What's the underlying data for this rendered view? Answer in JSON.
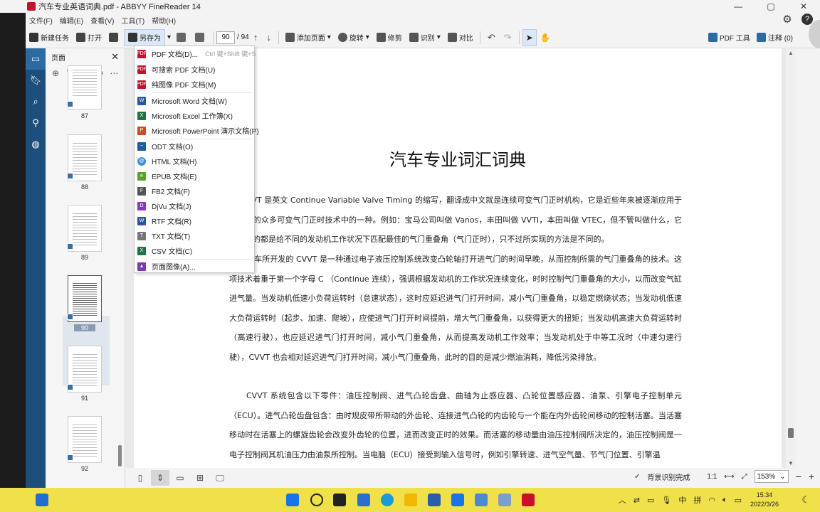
{
  "window": {
    "title": "汽车专业英语词典.pdf - ABBYY FineReader 14",
    "controls": [
      "—",
      "▢",
      "✕"
    ]
  },
  "menu": {
    "items": [
      "文件(F)",
      "编辑(E)",
      "查看(V)",
      "工具(T)",
      "帮助(H)"
    ]
  },
  "toolbar": {
    "new_task": "新建任务",
    "open": "打开",
    "save_as": "另存为",
    "page_current": "90",
    "page_total": "/ 94",
    "add_page": "添加页面",
    "rotate": "旋转",
    "edit": "修剪",
    "recognize": "识别",
    "compare": "对比",
    "pdf_tools": "PDF 工具",
    "comments": "注释 (0)"
  },
  "pages_panel": {
    "title": "页面",
    "thumbnails": [
      "87",
      "88",
      "89",
      "90",
      "91",
      "92"
    ],
    "selected": "90"
  },
  "save_as_menu": [
    {
      "label": "PDF 文档(D)...",
      "shortcut": "Ctrl 键+Shift 键+S",
      "icon": "pdf-icon",
      "color": "#c8102e"
    },
    {
      "label": "可搜索 PDF 文档(U)",
      "shortcut": "",
      "icon": "pdf-icon",
      "color": "#c8102e"
    },
    {
      "label": "纯图像 PDF 文档(M)",
      "shortcut": "",
      "icon": "pdf-icon",
      "color": "#c8102e"
    },
    {
      "label": "Microsoft Word 文档(W)",
      "shortcut": "",
      "icon": "word-icon",
      "color": "#2b579a"
    },
    {
      "label": "Microsoft Excel 工作簿(X)",
      "shortcut": "",
      "icon": "excel-icon",
      "color": "#217346"
    },
    {
      "label": "Microsoft PowerPoint 演示文稿(P)",
      "shortcut": "",
      "icon": "powerpoint-icon",
      "color": "#d24726"
    },
    {
      "label": "ODT 文档(O)",
      "shortcut": "",
      "icon": "odt-icon",
      "color": "#1e5aa0"
    },
    {
      "label": "HTML 文档(H)",
      "shortcut": "",
      "icon": "html-icon",
      "color": "#3c8ed6"
    },
    {
      "label": "EPUB 文档(E)",
      "shortcut": "",
      "icon": "epub-icon",
      "color": "#5aa02c"
    },
    {
      "label": "FB2 文档(F)",
      "shortcut": "",
      "icon": "fb2-icon",
      "color": "#555555"
    },
    {
      "label": "DjVu 文档(J)",
      "shortcut": "",
      "icon": "djvu-icon",
      "color": "#8a3ab9"
    },
    {
      "label": "RTF 文档(R)",
      "shortcut": "",
      "icon": "rtf-icon",
      "color": "#2b579a"
    },
    {
      "label": "TXT 文档(T)",
      "shortcut": "",
      "icon": "txt-icon",
      "color": "#777777"
    },
    {
      "label": "CSV 文档(C)",
      "shortcut": "",
      "icon": "csv-icon",
      "color": "#217346"
    },
    {
      "label": "页面图像(A)...",
      "shortcut": "",
      "icon": "image-icon",
      "color": "#7a3bb0"
    }
  ],
  "document": {
    "title": "汽车专业词汇词典",
    "paragraphs": [
      "VVT 是英文 Continue Variable Valve Timing 的缩写，翻译成中文就是连续可变气门正时机构，它是近些年来被逐渐应用于轿车上的众多可变气门正时技术中的一种。例如：宝马公司叫做 Vanos，丰田叫做 VVTI，本田叫做 VTEC，但不管叫做什么，它们的目的都是给不同的发动机工作状况下匹配最佳的气门重叠角（气门正时），只不过所实现的方法是不同的。",
      "汽车所开发的 CVVT 是一种通过电子液压控制系统改变凸轮轴打开进气门的时间早晚，从而控制所需的气门重叠角的技术。这项技术着重于第一个字母 C （Continue 连续），强调根据发动机的工作状况连续变化，时时控制气门重叠角的大小，以而改变气缸进气量。当发动机低速小负荷运转时（怠速状态），这时应延迟进气门打开时间，减小气门重叠角，以稳定燃烧状态；当发动机低速大负荷运转时（起步、加速、爬坡），应使进气门打开时间提前，增大气门重叠角，以获得更大的扭矩；当发动机高速大负荷运转时（高速行驶），也应延迟进气门打开时间，减小气门重叠角，从而提高发动机工作效率；当发动机处于中等工况时（中速匀速行驶），CVVT 也会相对延迟进气门打开时间，减小气门重叠角，此时的目的是减少燃油消耗，降低污染排放。",
      "CVVT 系统包含以下零件：油压控制阀、进气凸轮齿盘、曲轴为止感应器、凸轮位置感应器、油泵、引擎电子控制单元（ECU）。进气凸轮齿盘包含：由时规皮带所带动的外齿轮、连接进气凸轮的内齿轮与一个能在内外齿轮间移动的控制活塞。当活塞移动时在活塞上的螺旋齿轮会改变外齿轮的位置，进而改变正时的效果。而活塞的移动量由油压控制阀所决定的，油压控制阀是一电子控制阀其机油压力由油泵所控制。当电脑（ECU）接受到输入信号时，例如引擎转速、进气空气量、节气门位置、引擎温"
    ]
  },
  "status": {
    "bg_recognition": "背景识别完成",
    "ratio": "1:1",
    "zoom": "153%"
  },
  "taskbar": {
    "ime1": "中",
    "ime2": "拼",
    "time": "15:34",
    "date": "2022/3/26"
  }
}
